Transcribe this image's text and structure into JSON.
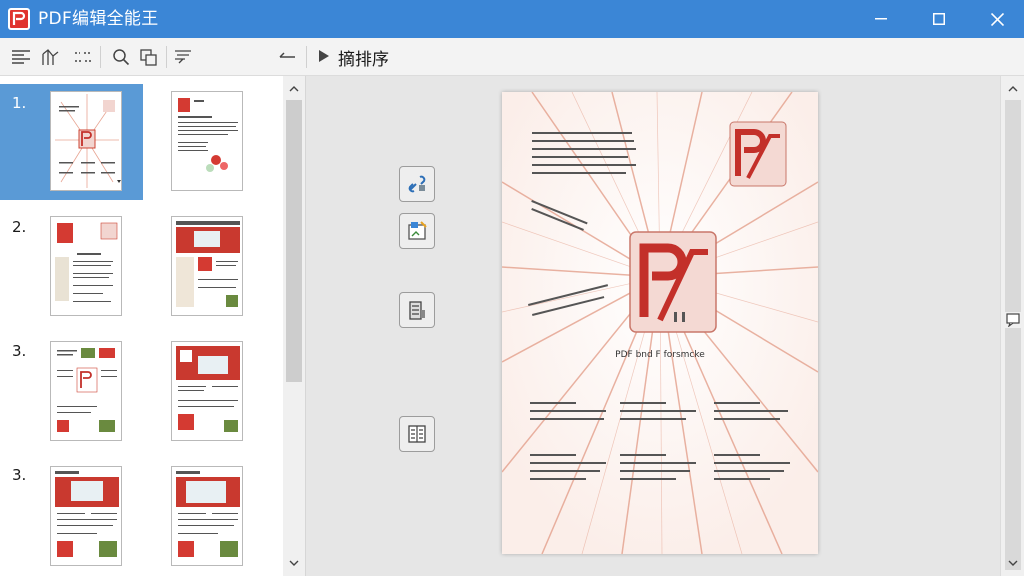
{
  "window": {
    "title": "PDF编辑全能王"
  },
  "toolbar": {
    "sort_label": "摘排序",
    "icons": [
      "align-left-icon",
      "split-icon",
      "rows-icon",
      "search-icon",
      "copy-pages-icon",
      "filter-icon",
      "back-arrow-icon",
      "play-icon"
    ]
  },
  "thumbnails": {
    "rows": [
      {
        "label": "1.",
        "selected": true
      },
      {
        "label": "2.",
        "selected": false
      },
      {
        "label": "3.",
        "selected": false
      },
      {
        "label": "3.",
        "selected": false
      }
    ]
  },
  "tools": {
    "icons": [
      "link-tool-icon",
      "image-edit-tool-icon",
      "document-stack-tool-icon",
      "book-tool-icon"
    ]
  },
  "page": {
    "caption": "PDF bnd F forsmcke"
  },
  "colors": {
    "titlebar": "#3b86d6",
    "brand_red": "#e0342f",
    "selection": "#5a9ad6"
  }
}
